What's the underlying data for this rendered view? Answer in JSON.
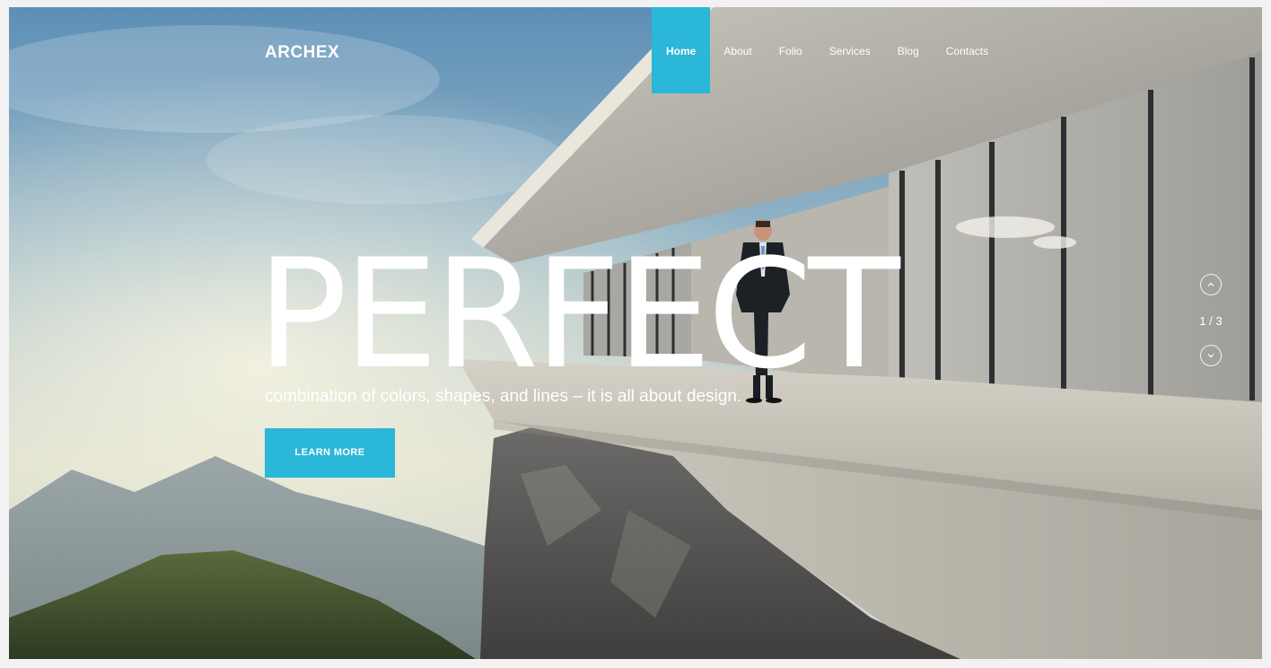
{
  "brand": {
    "name": "ARCHEX"
  },
  "nav": {
    "items": [
      {
        "label": "Home",
        "active": true
      },
      {
        "label": "About",
        "active": false
      },
      {
        "label": "Folio",
        "active": false
      },
      {
        "label": "Services",
        "active": false
      },
      {
        "label": "Blog",
        "active": false
      },
      {
        "label": "Contacts",
        "active": false
      }
    ]
  },
  "hero": {
    "headline": "PERFECT",
    "tagline": "combination of colors, shapes, and lines – it is all about design.",
    "cta_label": "LEARN MORE"
  },
  "slider": {
    "counter": "1 / 3",
    "up_icon": "chevron-up-icon",
    "down_icon": "chevron-down-icon"
  },
  "colors": {
    "accent": "#2ab7d8",
    "text": "#ffffff",
    "page_border": "#f2f2f2"
  }
}
